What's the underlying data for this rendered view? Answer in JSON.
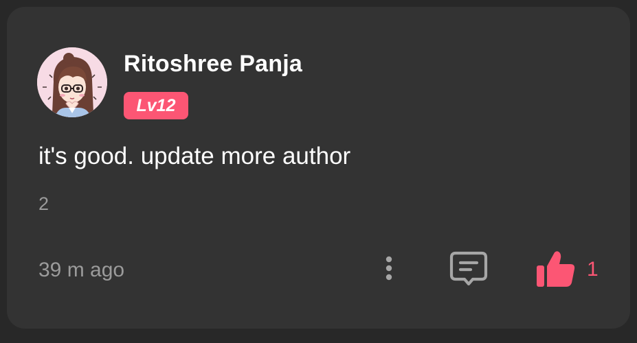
{
  "comment": {
    "author": "Ritoshree Panja",
    "level_badge": "Lv12",
    "text": "it's good. update more author",
    "reply_count": "2",
    "timestamp": "39 m ago",
    "like_count": "1"
  },
  "icons": {
    "avatar": "avatar-anime-girl-icon",
    "more": "more-vertical-icon",
    "reply": "comment-bubble-icon",
    "like": "thumbs-up-icon"
  },
  "colors": {
    "page_background": "#282828",
    "card_background": "#333333",
    "accent": "#fc5674",
    "primary_text": "#ffffff",
    "secondary_text": "#9b9b9b",
    "icon_gray": "#a6a6a6"
  }
}
